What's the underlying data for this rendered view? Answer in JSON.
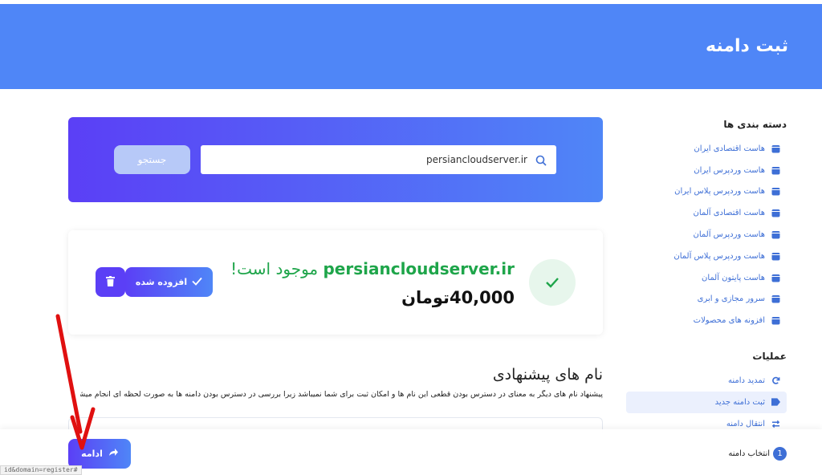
{
  "header": {
    "title": "ثبت دامنه"
  },
  "sidebar": {
    "categories_title": "دسته بندی ها",
    "categories": [
      {
        "label": "هاست اقتصادی ایران",
        "icon": "box-icon"
      },
      {
        "label": "هاست وردپرس ایران",
        "icon": "box-icon"
      },
      {
        "label": "هاست وردپرس پلاس ایران",
        "icon": "box-icon"
      },
      {
        "label": "هاست اقتصادی آلمان",
        "icon": "box-icon"
      },
      {
        "label": "هاست وردپرس آلمان",
        "icon": "box-icon"
      },
      {
        "label": "هاست وردپرس پلاس آلمان",
        "icon": "box-icon"
      },
      {
        "label": "هاست پایتون آلمان",
        "icon": "box-icon"
      },
      {
        "label": "سرور مجازی و ابری",
        "icon": "box-icon"
      },
      {
        "label": "افزونه های محصولات",
        "icon": "box-icon"
      }
    ],
    "actions_title": "عملیات",
    "actions": [
      {
        "label": "تمدید دامنه",
        "icon": "refresh-icon"
      },
      {
        "label": "ثبت دامنه جدید",
        "icon": "tag-icon"
      },
      {
        "label": "انتقال دامنه",
        "icon": "transfer-icon"
      }
    ]
  },
  "search": {
    "value": "persiancloudserver.ir",
    "button": "جستجو"
  },
  "result": {
    "domain": "persiancloudserver.ir",
    "available_text": "موجود است!",
    "price": "40,000تومان",
    "added_button": "افزوده شده"
  },
  "suggestions": {
    "title": "نام های پیشنهادی",
    "description": "پیشنهاد نام های دیگر به معنای در دسترس بودن قطعی این نام ها و امکان ثبت برای شما نمیباشد زیرا بررسی در دسترس بودن دامنه ها به صورت لحظه ای انجام میشود"
  },
  "footer": {
    "continue_button": "ادامه",
    "step_number": "1",
    "step_label": "انتخاب دامنه"
  },
  "statusbar": {
    "text": "id&domain=register#"
  },
  "colors": {
    "brand_blue": "#4f86f7",
    "brand_purple": "#5b3ff6",
    "success_green": "#1ea54a",
    "annotation_red": "#e01010"
  }
}
